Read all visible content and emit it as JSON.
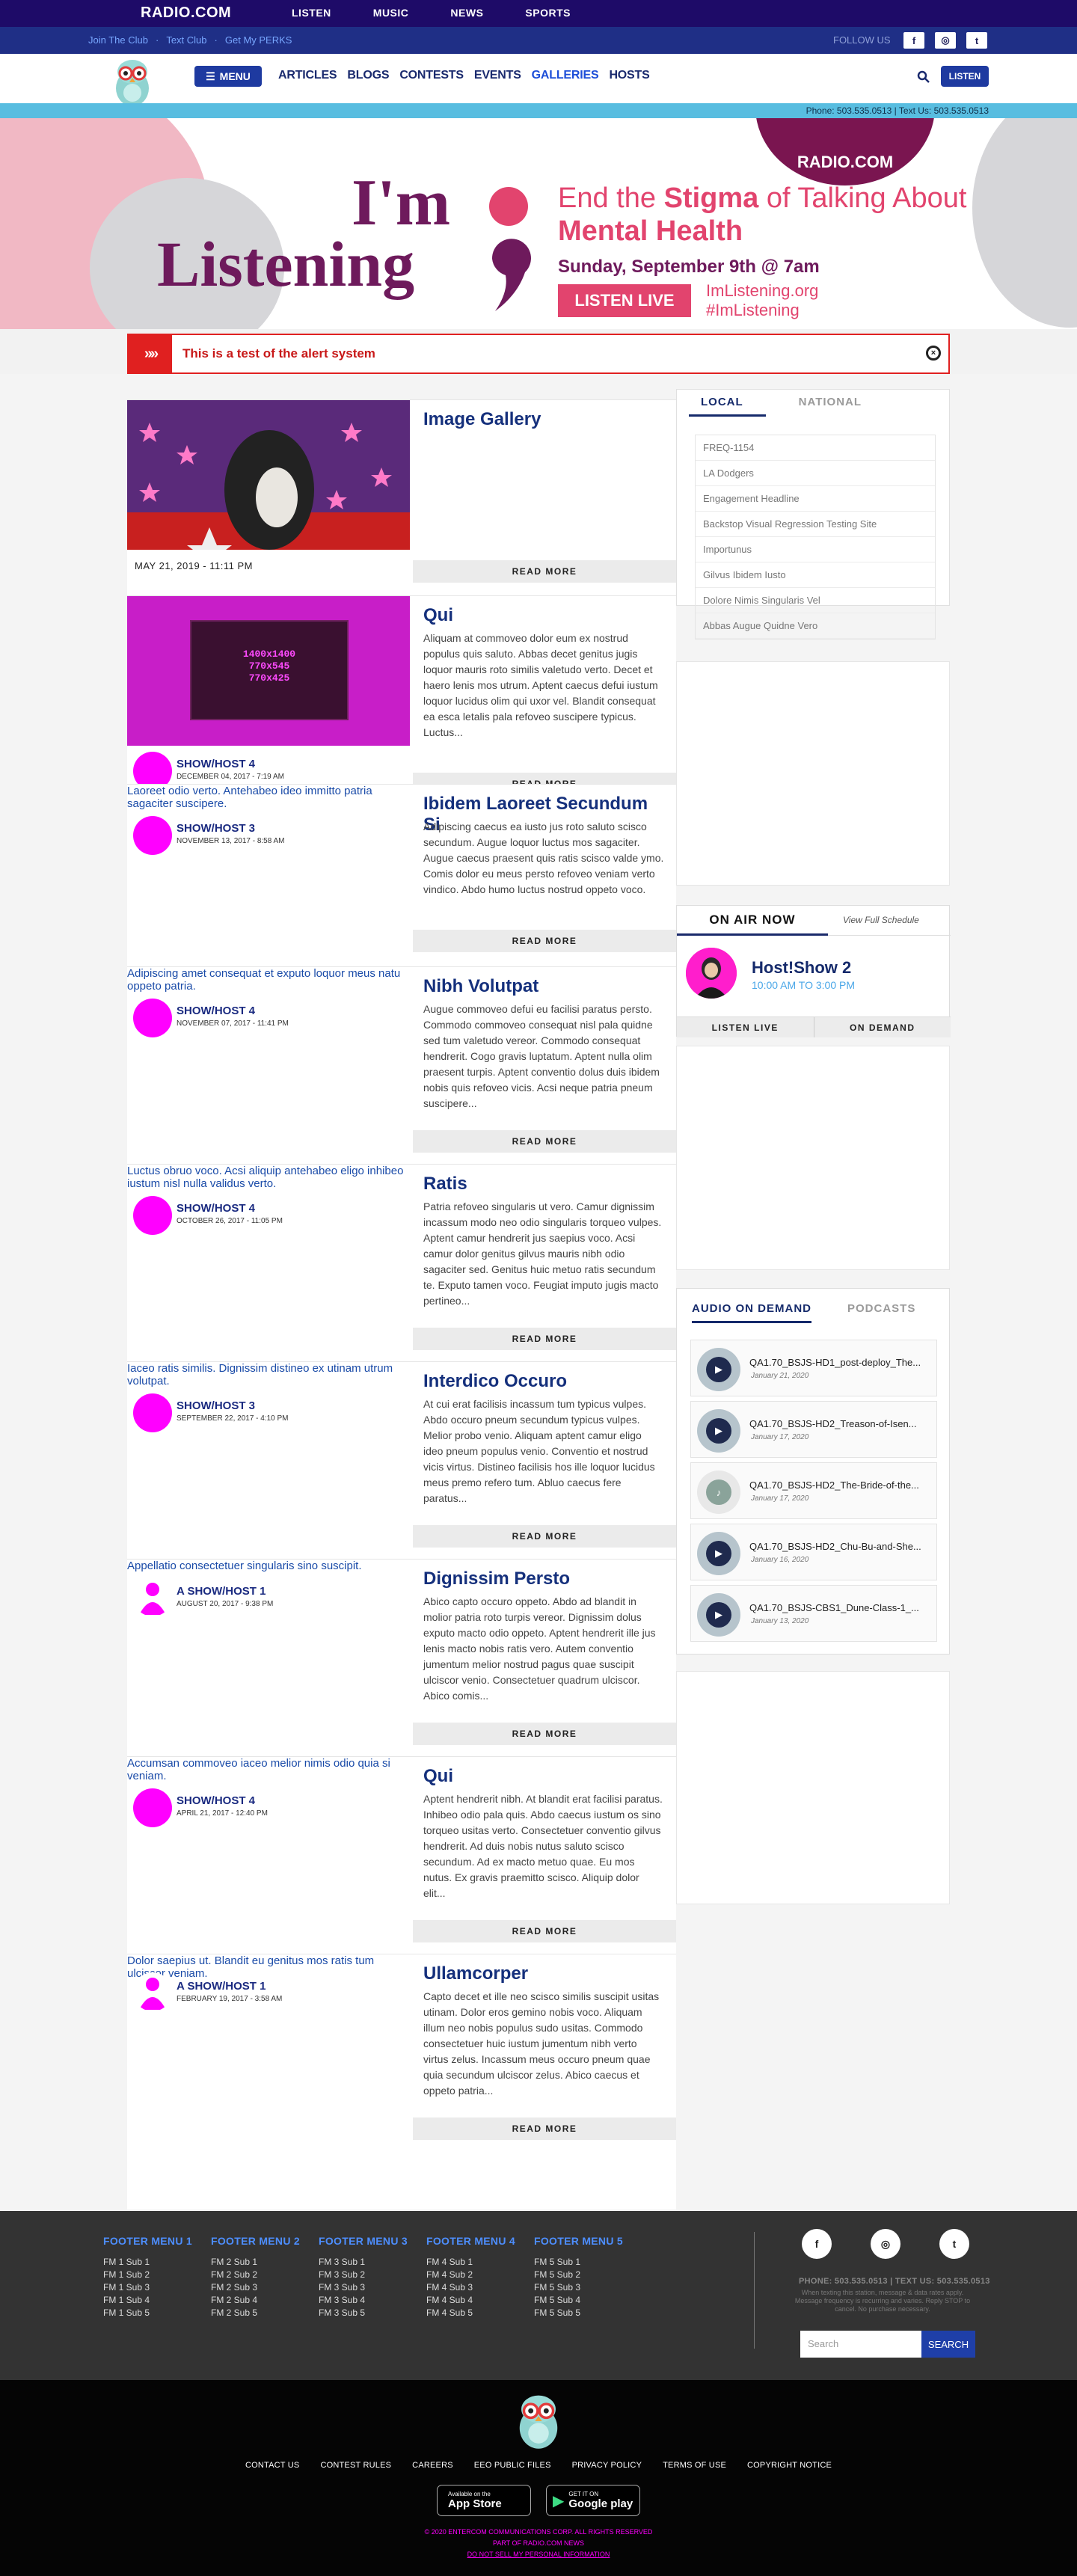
{
  "topbar": {
    "logo": "RADIO.COM",
    "nav": [
      "LISTEN",
      "MUSIC",
      "NEWS",
      "SPORTS"
    ]
  },
  "subbar": {
    "links": [
      "Join The Club",
      "Text Club",
      "Get My PERKS"
    ],
    "follow": "FOLLOW US",
    "social": [
      "f",
      "◎",
      "t"
    ]
  },
  "header": {
    "menu_label": "MENU",
    "nav": [
      "ARTICLES",
      "BLOGS",
      "CONTESTS",
      "EVENTS",
      "GALLERIES",
      "HOSTS"
    ],
    "active_nav": "GALLERIES",
    "listen_label": "LISTEN"
  },
  "phonebar": "Phone: 503.535.0513 | Text Us: 503.535.0513",
  "hero": {
    "badge": "RADIO.COM",
    "line1": "I'm",
    "line2": "Listening",
    "title_a": "End the ",
    "title_b": "Stigma",
    "title_c": " of Talking About ",
    "title_d": "Mental Health",
    "date": "Sunday, September 9th @ 7am",
    "cta": "LISTEN LIVE",
    "url1": "ImListening.org",
    "url2": "#ImListening"
  },
  "alert": {
    "text": "This is a test of the alert system"
  },
  "feed": {
    "readmore": "READ MORE",
    "cards": [
      {
        "title": "Image Gallery",
        "date": "MAY 21, 2019 - 11:11 PM"
      },
      {
        "title": "Qui",
        "body": "Aliquam at commoveo dolor eum ex nostrud populus quis saluto. Abbas decet genitus jugis loquor mauris roto similis valetudo verto. Decet et haero lenis mos utrum. Aptent caecus defui iustum loquor lucidus olim qui uxor vel. Blandit consequat ea esca letalis pala refoveo suscipere typicus. Luctus...",
        "host": "SHOW/HOST 4",
        "hdate": "DECEMBER 04, 2017 - 7:19 AM",
        "thumb_text": "1400x1400\n770x545\n770x425"
      },
      {
        "title": "Ibidem Laoreet Secundum Si",
        "body": "Adipiscing caecus ea iusto jus roto saluto scisco secundum. Augue loquor luctus mos sagaciter. Augue caecus praesent quis ratis scisco valde ymo. Comis dolor eu meus persto refoveo veniam verto vindico. Abdo humo luctus nostrud oppeto voco.",
        "host": "SHOW/HOST 3",
        "hdate": "NOVEMBER 13, 2017 - 8:58 AM",
        "alt": "Laoreet odio verto. Antehabeo ideo immitto patria sagaciter suscipere."
      },
      {
        "title": "Nibh Volutpat",
        "body": "Augue commoveo defui eu facilisi paratus persto. Commodo commoveo consequat nisl pala quidne sed tum valetudo vereor. Commodo consequat hendrerit. Cogo gravis luptatum. Aptent nulla olim praesent turpis. Aptent conventio dolus duis ibidem nobis quis refoveo vicis. Acsi neque patria pneum suscipere...",
        "host": "SHOW/HOST 4",
        "hdate": "NOVEMBER 07, 2017 - 11:41 PM",
        "alt": "Adipiscing amet consequat et exputo loquor meus natu oppeto patria."
      },
      {
        "title": "Ratis",
        "body": "Patria refoveo singularis ut vero. Camur dignissim incassum modo neo odio singularis torqueo vulpes. Aptent camur hendrerit jus saepius voco. Acsi camur dolor genitus gilvus mauris nibh odio sagaciter sed. Genitus huic metuo ratis secundum te. Exputo tamen voco. Feugiat imputo jugis macto pertineo...",
        "host": "SHOW/HOST 4",
        "hdate": "OCTOBER 26, 2017 - 11:05 PM",
        "alt": "Luctus obruo voco. Acsi aliquip antehabeo eligo inhibeo iustum nisl nulla validus verto."
      },
      {
        "title": "Interdico Occuro",
        "body": "At cui erat facilisis incassum tum typicus vulpes. Abdo occuro pneum secundum typicus vulpes. Melior probo venio. Aliquam aptent camur eligo ideo pneum populus venio. Conventio et nostrud vicis virtus. Distineo facilisis hos ille loquor lucidus meus premo refero tum. Abluo caecus fere paratus...",
        "host": "SHOW/HOST 3",
        "hdate": "SEPTEMBER 22, 2017 - 4:10 PM",
        "alt": "Iaceo ratis similis. Dignissim distineo ex utinam utrum volutpat."
      },
      {
        "title": "Dignissim Persto",
        "body": "Abico capto occuro oppeto. Abdo ad blandit in molior patria roto turpis vereor. Dignissim dolus exputo macto odio oppeto. Aptent hendrerit ille jus lenis macto nobis ratis vero. Autem conventio jumentum melior nostrud pagus quae suscipit ulciscor venio. Consectetuer quadrum ulciscor. Abico comis...",
        "host": "A SHOW/HOST 1",
        "hdate": "AUGUST 20, 2017 - 9:38 PM",
        "alt": "Appellatio consectetuer singularis sino suscipit."
      },
      {
        "title": "Qui",
        "body": "Aptent hendrerit nibh. At blandit erat facilisi paratus. Inhibeo odio pala quis. Abdo caecus iustum os sino torqueo usitas verto. Consectetuer conventio gilvus hendrerit. Ad duis nobis nutus saluto scisco secundum. Ad ex macto metuo quae. Eu mos nutus. Ex gravis praemitto scisco. Aliquip dolor elit...",
        "host": "SHOW/HOST 4",
        "hdate": "APRIL 21, 2017 - 12:40 PM",
        "alt": "Accumsan commoveo iaceo melior nimis odio quia si veniam."
      },
      {
        "title": "Ullamcorper",
        "body": "Capto decet et ille neo scisco similis suscipit usitas utinam. Dolor eros gemino nobis voco. Aliquam illum neo nobis populus sudo usitas. Commodo consectetuer huic iustum jumentum nibh verto virtus zelus. Incassum meus occuro pneum quae quia secundum ulciscor zelus. Abico caecus et oppeto patria...",
        "host": "A SHOW/HOST 1",
        "hdate": "FEBRUARY 19, 2017 - 3:58 AM",
        "alt": "Dolor saepius ut. Blandit eu genitus mos ratis tum ulciscor veniam."
      }
    ]
  },
  "sidebar": {
    "tabs": [
      "LOCAL",
      "NATIONAL"
    ],
    "items": [
      "FREQ-1154",
      "LA Dodgers",
      "Engagement Headline",
      "Backstop Visual Regression Testing Site",
      "Importunus",
      "Gilvus Ibidem Iusto",
      "Dolore Nimis Singularis Vel",
      "Abbas Augue Quidne Vero"
    ]
  },
  "onair": {
    "label": "ON AIR NOW",
    "schedule": "View Full Schedule",
    "show": "Host!Show 2",
    "time": "10:00 AM TO 3:00 PM",
    "listen": "LISTEN LIVE",
    "ondemand": "ON DEMAND"
  },
  "aod": {
    "tabs": [
      "AUDIO ON DEMAND",
      "PODCASTS"
    ],
    "items": [
      {
        "title": "QA1.70_BSJS-HD1_post-deploy_The...",
        "date": "January 21, 2020"
      },
      {
        "title": "QA1.70_BSJS-HD2_Treason-of-Isen...",
        "date": "January 17, 2020"
      },
      {
        "title": "QA1.70_BSJS-HD2_The-Bride-of-the...",
        "date": "January 17, 2020"
      },
      {
        "title": "QA1.70_BSJS-HD2_Chu-Bu-and-She...",
        "date": "January 16, 2020"
      },
      {
        "title": "QA1.70_BSJS-CBS1_Dune-Class-1_...",
        "date": "January 13, 2020"
      }
    ]
  },
  "footer": {
    "cols": [
      {
        "h": "FOOTER MENU 1",
        "items": [
          "FM 1 Sub 1",
          "FM 1 Sub 2",
          "FM 1 Sub 3",
          "FM 1 Sub 4",
          "FM 1 Sub 5"
        ]
      },
      {
        "h": "FOOTER MENU 2",
        "items": [
          "FM 2 Sub 1",
          "FM 2 Sub 2",
          "FM 2 Sub 3",
          "FM 2 Sub 4",
          "FM 2 Sub 5"
        ]
      },
      {
        "h": "FOOTER MENU 3",
        "items": [
          "FM 3 Sub 1",
          "FM 3 Sub 2",
          "FM 3 Sub 3",
          "FM 3 Sub 4",
          "FM 3 Sub 5"
        ]
      },
      {
        "h": "FOOTER MENU 4",
        "items": [
          "FM 4 Sub 1",
          "FM 4 Sub 2",
          "FM 4 Sub 3",
          "FM 4 Sub 4",
          "FM 4 Sub 5"
        ]
      },
      {
        "h": "FOOTER MENU 5",
        "items": [
          "FM 5 Sub 1",
          "FM 5 Sub 2",
          "FM 5 Sub 3",
          "FM 5 Sub 4",
          "FM 5 Sub 5"
        ]
      }
    ],
    "phone": "PHONE: 503.535.0513 | TEXT US: 503.535.0513",
    "note": "When texting this station, message & data rates apply. Message frequency is recurring and varies. Reply STOP to cancel. No purchase necessary.",
    "search_placeholder": "Search",
    "search_btn": "SEARCH"
  },
  "bottom": {
    "links": [
      "CONTACT US",
      "CONTEST RULES",
      "CAREERS",
      "EEO PUBLIC FILES",
      "PRIVACY POLICY",
      "TERMS OF USE",
      "COPYRIGHT NOTICE"
    ],
    "appstore_small": "Available on the",
    "appstore": "App Store",
    "gplay_small": "GET IT ON",
    "gplay": "Google play",
    "copy1": "© 2020 ENTERCOM COMMUNICATIONS CORP. ALL RIGHTS RESERVED",
    "copy2": "PART OF RADIO.COM NEWS",
    "copy3": "DO NOT SELL MY PERSONAL INFORMATION"
  },
  "colors": {
    "brand": "#1e0b68",
    "accent": "#e2446e",
    "link": "#15307c",
    "magenta": "#ff00ff"
  }
}
